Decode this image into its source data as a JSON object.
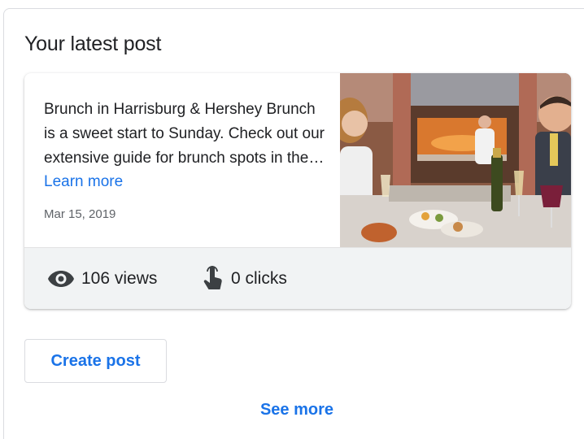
{
  "section": {
    "title": "Your latest post"
  },
  "post": {
    "headline": "Brunch in Harrisburg & Hershey Brunch is a sweet start to Sunday. Check out our extensive guide for brunch spots in the area.",
    "learn_more_label": "Learn more",
    "date": "Mar 15, 2019",
    "image_icon": "brunch-photo"
  },
  "stats": {
    "views_icon": "eye-icon",
    "views_label": "106 views",
    "clicks_icon": "touch-icon",
    "clicks_label": "0 clicks"
  },
  "actions": {
    "create_post_label": "Create post",
    "see_more_label": "See more"
  },
  "colors": {
    "link": "#1a73e8",
    "border": "#dadce0",
    "stats_background": "#f1f3f4"
  }
}
